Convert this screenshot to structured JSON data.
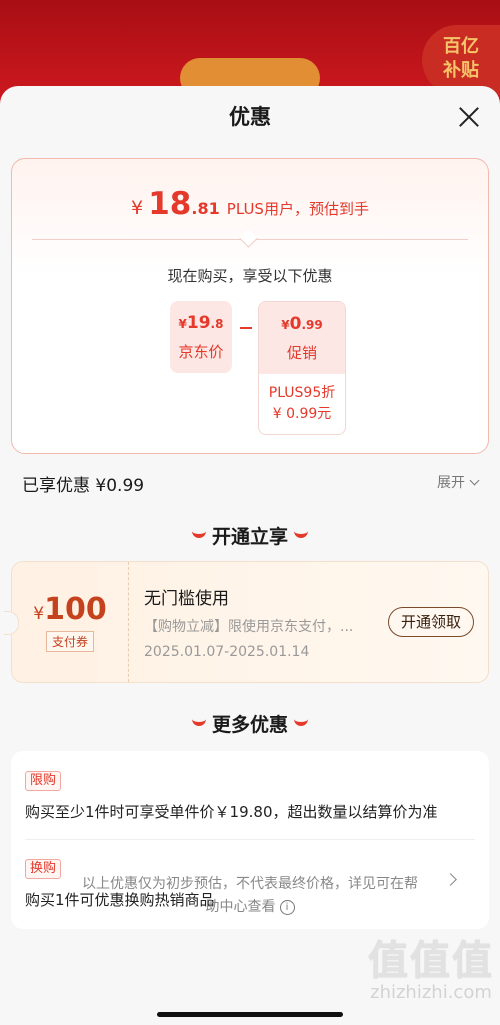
{
  "background": {
    "badge_line1": "百亿",
    "badge_line2": "补贴"
  },
  "sheet": {
    "title": "优惠"
  },
  "estimate": {
    "currency": "¥",
    "price_int": "18",
    "price_dec": ".81",
    "label": "PLUS用户，预估到手",
    "now_text": "现在购买，享受以下优惠",
    "jd_price": {
      "currency": "¥",
      "int": "19",
      "dec": ".8",
      "label": "京东价"
    },
    "promo": {
      "currency": "¥",
      "int": "0",
      "dec": ".99",
      "label": "促销",
      "detail1": "PLUS95折",
      "detail2": "¥ 0.99元"
    }
  },
  "summary": {
    "enjoyed": "已享优惠 ¥0.99",
    "expand": "展开"
  },
  "open_section": {
    "title": "开通立享",
    "coupon": {
      "currency": "¥",
      "amount": "100",
      "type": "支付券",
      "name": "无门槛使用",
      "desc": "【购物立减】限使用京东支付，...",
      "date": "2025.01.07-2025.01.14",
      "button": "开通领取"
    }
  },
  "more_section": {
    "title": "更多优惠",
    "items": [
      {
        "tag": "限购",
        "text": "购买至少1件时可享受单件价￥19.80，超出数量以结算价为准"
      },
      {
        "tag": "换购",
        "text": "购买1件可优惠换购热销商品"
      }
    ]
  },
  "disclaimer": {
    "line1": "以上优惠仅为初步预估，不代表最终价格，详见可在帮",
    "line2": "助中心查看"
  },
  "watermark": {
    "big": "值值值",
    "small": "zhizhizhi.com"
  },
  "colors": {
    "accent": "#e4392b",
    "coupon_text": "#c4421e"
  }
}
